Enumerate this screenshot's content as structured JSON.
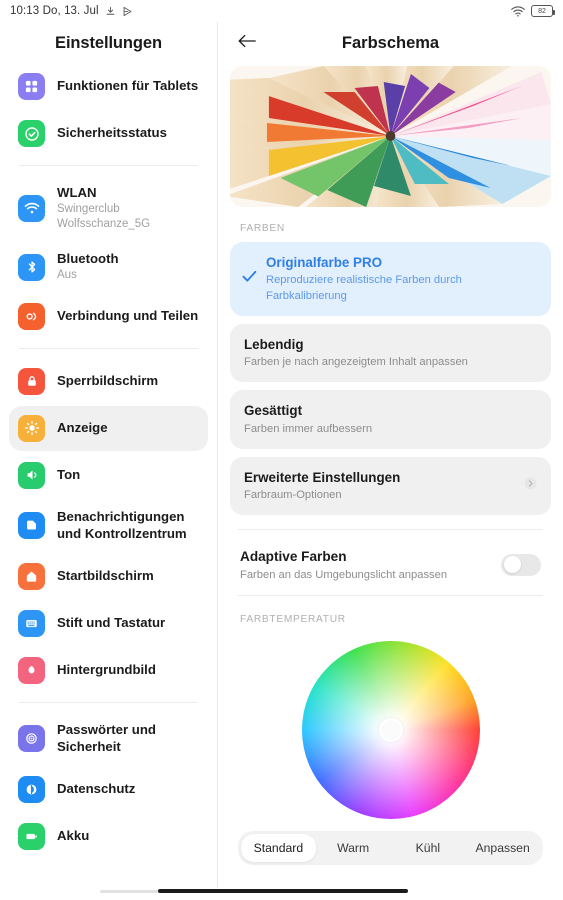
{
  "statusbar": {
    "time": "10:13 Do, 13. Jul",
    "left_icons": [
      "dnd-icon",
      "location-share-icon"
    ],
    "wifi_icon": "wifi-icon",
    "battery_level": "82"
  },
  "sidebar": {
    "title": "Einstellungen",
    "groups": [
      {
        "items": [
          {
            "label": "Funktionen für Tablets",
            "sub": "",
            "icon": "grid-apps-icon",
            "color": "#8a7ef0",
            "active": false
          },
          {
            "label": "Sicherheitsstatus",
            "sub": "",
            "icon": "shield-check-icon",
            "color": "#2ad06a",
            "active": false
          }
        ]
      },
      {
        "items": [
          {
            "label": "WLAN",
            "sub": "Swingerclub Wolfsschanze_5G",
            "icon": "wifi-icon",
            "color": "#2d95f5",
            "active": false
          },
          {
            "label": "Bluetooth",
            "sub": "Aus",
            "icon": "bluetooth-icon",
            "color": "#2d95f5",
            "active": false
          },
          {
            "label": "Verbindung und Teilen",
            "sub": "",
            "icon": "share-link-icon",
            "color": "#f4602e",
            "active": false
          }
        ]
      },
      {
        "items": [
          {
            "label": "Sperrbildschirm",
            "sub": "",
            "icon": "lock-icon",
            "color": "#f4553c",
            "active": false
          },
          {
            "label": "Anzeige",
            "sub": "",
            "icon": "brightness-sun-icon",
            "color": "#f7b13a",
            "active": true
          },
          {
            "label": "Ton",
            "sub": "",
            "icon": "speaker-icon",
            "color": "#28cc6e",
            "active": false
          },
          {
            "label": "Benachrichtigungen und Kontrollzentrum",
            "sub": "",
            "icon": "notification-icon",
            "color": "#1e8cf2",
            "active": false
          },
          {
            "label": "Startbildschirm",
            "sub": "",
            "icon": "home-icon",
            "color": "#f8703b",
            "active": false
          },
          {
            "label": "Stift und Tastatur",
            "sub": "",
            "icon": "keyboard-icon",
            "color": "#2d95f5",
            "active": false
          },
          {
            "label": "Hintergrundbild",
            "sub": "",
            "icon": "wallpaper-flower-icon",
            "color": "#f3647f",
            "active": false
          }
        ]
      },
      {
        "items": [
          {
            "label": "Passwörter und Sicherheit",
            "sub": "",
            "icon": "fingerprint-icon",
            "color": "#7a74ea",
            "active": false
          },
          {
            "label": "Datenschutz",
            "sub": "",
            "icon": "privacy-icon",
            "color": "#1e8cf2",
            "active": false
          },
          {
            "label": "Akku",
            "sub": "",
            "icon": "battery-icon",
            "color": "#2ad06a",
            "active": false
          }
        ]
      }
    ]
  },
  "detail": {
    "back_icon": "arrow-left-icon",
    "title": "Farbschema",
    "banner_alt": "colored-pencils-photo",
    "colors_section_label": "Farben",
    "options": [
      {
        "title": "Originalfarbe PRO",
        "sub": "Reproduziere realistische Farben durch Farbkalibrierung",
        "selected": true,
        "chevron": false
      },
      {
        "title": "Lebendig",
        "sub": "Farben je nach angezeigtem Inhalt anpassen",
        "selected": false,
        "chevron": false
      },
      {
        "title": "Gesättigt",
        "sub": "Farben immer aufbessern",
        "selected": false,
        "chevron": false
      },
      {
        "title": "Erweiterte Einstellungen",
        "sub": "Farbraum-Optionen",
        "selected": false,
        "chevron": true
      }
    ],
    "adaptive": {
      "title": "Adaptive Farben",
      "sub": "Farben an das Umgebungslicht anpassen",
      "enabled": false
    },
    "temperature_section_label": "Farbtemperatur",
    "temperature_tabs": [
      {
        "label": "Standard",
        "active": true
      },
      {
        "label": "Warm",
        "active": false
      },
      {
        "label": "Kühl",
        "active": false
      },
      {
        "label": "Anpassen",
        "active": false
      }
    ]
  },
  "theme": {
    "accent_blue": "#2f7fe6",
    "selected_card_bg": "#e2effc",
    "card_bg": "#f0f0f0",
    "sidebar_active_bg": "#f0f0f0"
  }
}
